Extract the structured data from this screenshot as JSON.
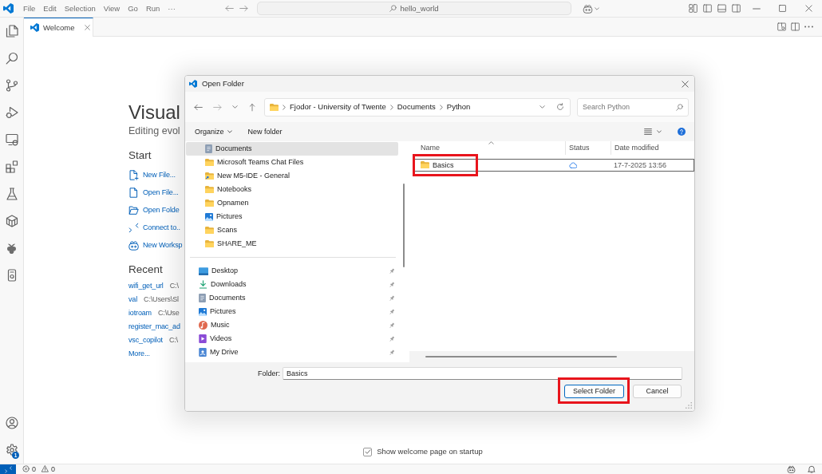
{
  "title_bar": {
    "menus": [
      "File",
      "Edit",
      "Selection",
      "View",
      "Go",
      "Run",
      "···"
    ],
    "command_center": {
      "label": "hello_world"
    }
  },
  "activity_bar": {
    "settings_badge": "1"
  },
  "tabs": [
    {
      "label": "Welcome",
      "selected": true
    }
  ],
  "welcome": {
    "title": "Visual",
    "subtitle": "Editing evol",
    "start": {
      "heading": "Start",
      "items": [
        {
          "kind": "new-file",
          "label": "New File..."
        },
        {
          "kind": "open-file",
          "label": "Open File..."
        },
        {
          "kind": "open-folder",
          "label": "Open Folde"
        },
        {
          "kind": "connect",
          "label": "Connect to.."
        },
        {
          "kind": "new-workspace",
          "label": "New Worksp"
        }
      ]
    },
    "recent": {
      "heading": "Recent",
      "items": [
        {
          "name": "wifi_get_url",
          "path": "C:\\"
        },
        {
          "name": "val",
          "path": "C:\\Users\\Sl"
        },
        {
          "name": "iotroam",
          "path": "C:\\Use"
        },
        {
          "name": "register_mac_ad"
        },
        {
          "name": "vsc_copilot",
          "path": "C:\\"
        }
      ],
      "more": "More..."
    },
    "show_on_startup": {
      "label": "Show welcome page on startup",
      "checked": true
    }
  },
  "dialog": {
    "title": "Open Folder",
    "path": [
      "Fjodor - University of Twente",
      "Documents",
      "Python"
    ],
    "search": {
      "placeholder": "Search Python"
    },
    "toolbar": {
      "organize": "Organize",
      "new_folder": "New folder"
    },
    "nav_sections": [
      {
        "kind": "tree",
        "items": [
          {
            "kind": "documents",
            "label": "Documents",
            "selected": true,
            "pinned": false
          },
          {
            "kind": "folder",
            "label": "Microsoft Teams Chat Files",
            "selected": false,
            "pinned": false
          },
          {
            "kind": "shortcut-folder",
            "label": "New M5-IDE - General",
            "selected": false,
            "pinned": false
          },
          {
            "kind": "folder",
            "label": "Notebooks",
            "selected": false,
            "pinned": false
          },
          {
            "kind": "folder",
            "label": "Opnamen",
            "selected": false,
            "pinned": false
          },
          {
            "kind": "pictures",
            "label": "Pictures",
            "selected": false,
            "pinned": false
          },
          {
            "kind": "folder",
            "label": "Scans",
            "selected": false,
            "pinned": false
          },
          {
            "kind": "folder",
            "label": "SHARE_ME",
            "selected": false,
            "pinned": false
          }
        ]
      },
      {
        "kind": "quick-access",
        "items": [
          {
            "kind": "desktop",
            "label": "Desktop",
            "selected": false,
            "pinned": true
          },
          {
            "kind": "downloads",
            "label": "Downloads",
            "selected": false,
            "pinned": true
          },
          {
            "kind": "documents",
            "label": "Documents",
            "selected": false,
            "pinned": true
          },
          {
            "kind": "pictures",
            "label": "Pictures",
            "selected": false,
            "pinned": true
          },
          {
            "kind": "music",
            "label": "Music",
            "selected": false,
            "pinned": true
          },
          {
            "kind": "videos",
            "label": "Videos",
            "selected": false,
            "pinned": true
          },
          {
            "kind": "drive",
            "label": "My Drive",
            "selected": false,
            "pinned": true
          }
        ]
      }
    ],
    "columns": [
      {
        "label": "Name",
        "sorted": true
      },
      {
        "label": "Status",
        "sorted": false
      },
      {
        "label": "Date modified",
        "sorted": false
      }
    ],
    "rows": [
      {
        "name": "Basics",
        "online_only": true,
        "date": "17-7-2025 13:56",
        "selected": true,
        "highlighted": true
      }
    ],
    "folder_field": {
      "label": "Folder:",
      "value": "Basics"
    },
    "buttons": [
      {
        "label": "Select Folder",
        "default": true,
        "highlighted": true
      },
      {
        "label": "Cancel",
        "default": false,
        "highlighted": false
      }
    ]
  },
  "status_bar": {
    "errors": "0",
    "warnings": "0"
  }
}
